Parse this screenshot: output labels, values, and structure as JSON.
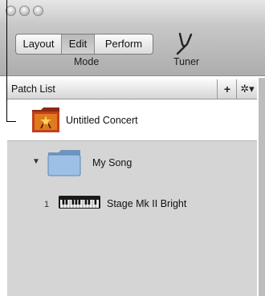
{
  "toolbar": {
    "segments": [
      "Layout",
      "Edit",
      "Perform"
    ],
    "active_segment": "Edit",
    "mode_label": "Mode",
    "tuner_label": "Tuner"
  },
  "patch_list": {
    "title": "Patch List",
    "add_button": "+",
    "action_button": "✲▾",
    "concert": {
      "name": "Untitled Concert",
      "icon": "concert-icon"
    },
    "song": {
      "name": "My Song",
      "icon": "folder-icon",
      "expanded": true
    },
    "patches": [
      {
        "number": "1",
        "name": "Stage Mk II Bright",
        "icon": "keyboard-icon"
      }
    ]
  },
  "colors": {
    "selected_row": "#ffffff",
    "list_background": "#d5d5d5",
    "toolbar": "#bcbcbc"
  }
}
